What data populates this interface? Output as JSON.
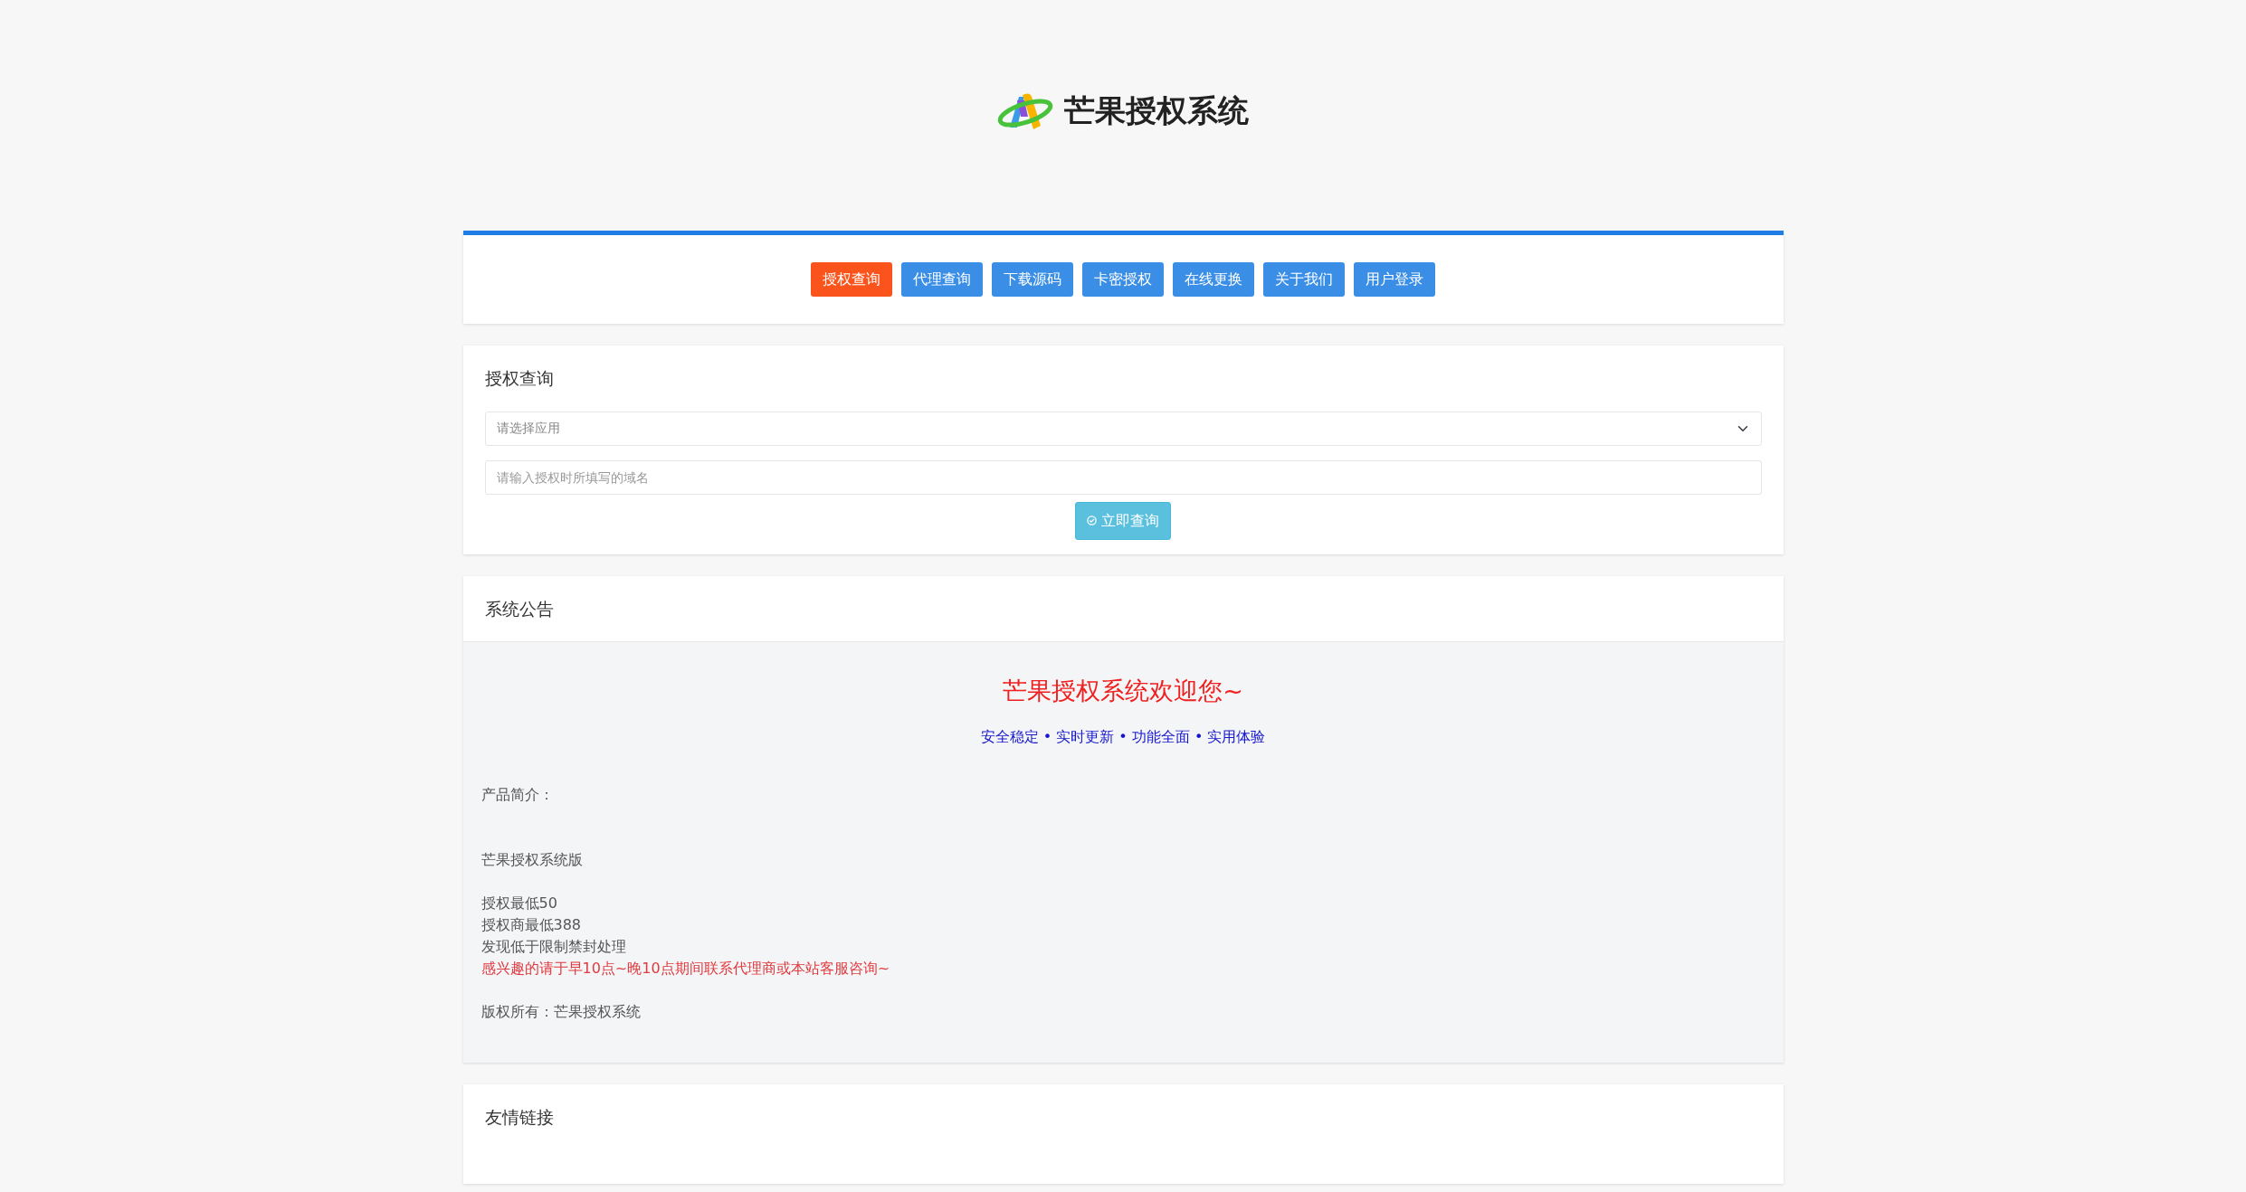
{
  "logo": {
    "title": "芒果授权系统"
  },
  "nav": [
    {
      "label": "授权查询",
      "selected": true
    },
    {
      "label": "代理查询",
      "selected": false
    },
    {
      "label": "下载源码",
      "selected": false
    },
    {
      "label": "卡密授权",
      "selected": false
    },
    {
      "label": "在线更换",
      "selected": false
    },
    {
      "label": "关于我们",
      "selected": false
    },
    {
      "label": "用户登录",
      "selected": false
    }
  ],
  "query": {
    "title": "授权查询",
    "select": {
      "placeholder": "请选择应用"
    },
    "domain": {
      "placeholder": "请输入授权时所填写的域名"
    },
    "button": "立即查询"
  },
  "notice": {
    "title": "系统公告",
    "heading": "芒果授权系统欢迎您~",
    "tagline": "安全稳定 • 实时更新 • 功能全面 • 实用体验",
    "blocks": [
      [
        {
          "text": "产品简介：",
          "kind": "plain"
        }
      ],
      [
        {
          "text": "芒果授权系统版",
          "kind": "plain"
        }
      ],
      [
        {
          "text": "授权最低50",
          "kind": "plain"
        },
        {
          "text": "授权商最低388",
          "kind": "plain"
        },
        {
          "text": "发现低于限制禁封处理",
          "kind": "plain"
        },
        {
          "text": "感兴趣的请于早10点~晚10点期间联系代理商或本站客服咨询~",
          "kind": "highlight"
        }
      ],
      [
        {
          "text": "版权所有：芒果授权系统",
          "kind": "plain"
        }
      ]
    ]
  },
  "links": {
    "title": "友情链接"
  }
}
